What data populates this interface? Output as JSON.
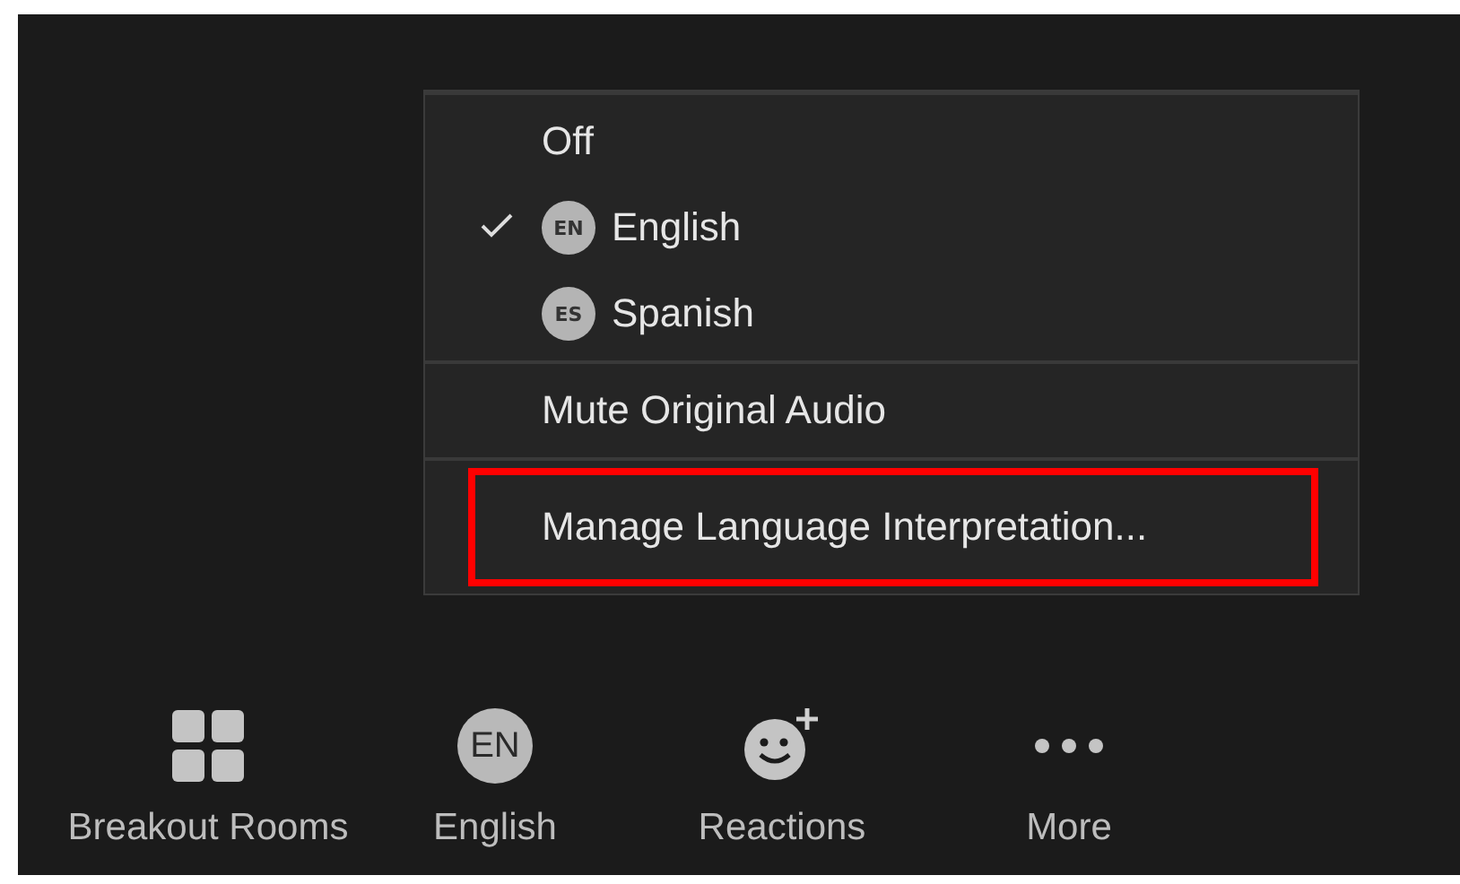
{
  "menu": {
    "sections": [
      [
        {
          "label": "Off",
          "checked": false
        },
        {
          "label": "English",
          "checked": true,
          "badge": "EN"
        },
        {
          "label": "Spanish",
          "checked": false,
          "badge": "ES"
        }
      ],
      [
        {
          "label": "Mute Original Audio",
          "checked": false
        }
      ],
      [
        {
          "label": "Manage Language Interpretation...",
          "checked": false,
          "highlighted": true
        }
      ]
    ]
  },
  "toolbar": [
    {
      "kind": "grid",
      "label": "Breakout Rooms"
    },
    {
      "kind": "badge",
      "badge": "EN",
      "label": "English"
    },
    {
      "kind": "reaction",
      "label": "Reactions"
    },
    {
      "kind": "dots",
      "label": "More"
    }
  ]
}
